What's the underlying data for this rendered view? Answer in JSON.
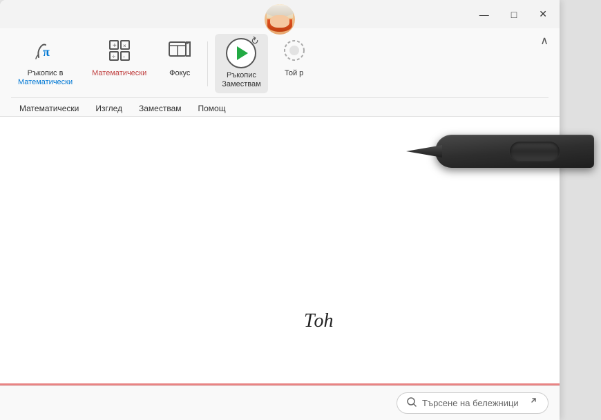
{
  "titlebar": {
    "minimize_label": "—",
    "maximize_label": "□",
    "close_label": "✕"
  },
  "ribbon": {
    "items": [
      {
        "id": "handwriting-math",
        "icon_type": "pi",
        "label_line1": "Ръкопис в",
        "label_line2": "Математически",
        "label_color": "normal"
      },
      {
        "id": "math",
        "icon_type": "grid",
        "label_line1": "Математически",
        "label_line2": "",
        "label_color": "red"
      },
      {
        "id": "focus",
        "icon_type": "focus",
        "label_line1": "Фокус",
        "label_line2": "",
        "label_color": "normal"
      },
      {
        "id": "handwriting-replay",
        "icon_type": "replay",
        "label_line1": "Ръкопис",
        "label_line2": "Замествам",
        "label_color": "normal",
        "active": true
      },
      {
        "id": "partial",
        "icon_type": "partial",
        "label_line1": "Той р",
        "label_line2": "",
        "label_color": "normal"
      }
    ],
    "tabs": [
      {
        "id": "math-tab",
        "label": "Математически",
        "active": false
      },
      {
        "id": "view-tab",
        "label": "Изглед",
        "active": false
      },
      {
        "id": "replace-tab",
        "label": "Замествам",
        "active": false
      },
      {
        "id": "help-tab",
        "label": "Помощ",
        "active": false
      }
    ],
    "collapse_label": "^"
  },
  "main": {
    "handwriting_text": "Тоh"
  },
  "bottom": {
    "search_placeholder": "Търсене на бележници",
    "expand_icon": "⤢"
  }
}
